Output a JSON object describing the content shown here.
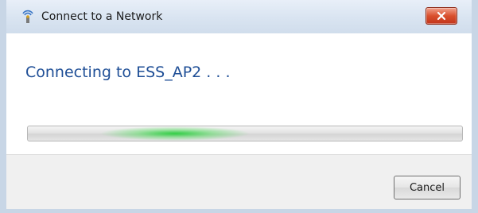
{
  "window": {
    "title": "Connect to a Network",
    "title_icon": "network-icon",
    "close_icon": "close-icon"
  },
  "content": {
    "message": "Connecting to ESS_AP2 . . ."
  },
  "progress": {
    "state": "indeterminate",
    "glow_color": "#2ecb45"
  },
  "footer": {
    "cancel_label": "Cancel"
  },
  "colors": {
    "message_text": "#1e4e96",
    "close_button": "#d9502d"
  }
}
